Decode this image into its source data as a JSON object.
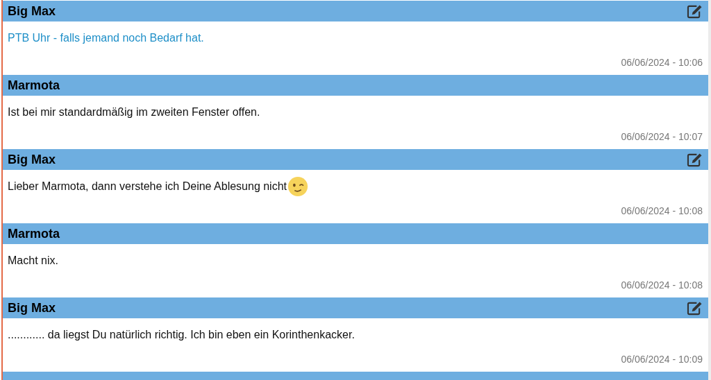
{
  "posts": [
    {
      "author": "Big Max",
      "editable": true,
      "body": {
        "kind": "link",
        "text": "PTB Uhr - falls jemand noch Bedarf hat."
      },
      "time": "06/06/2024 - 10:06"
    },
    {
      "author": "Marmota",
      "editable": false,
      "body": {
        "kind": "text",
        "text": "Ist bei mir standardmäßig im zweiten Fenster offen."
      },
      "time": "06/06/2024 - 10:07"
    },
    {
      "author": "Big Max",
      "editable": true,
      "body": {
        "kind": "text",
        "text": "Lieber Marmota, dann verstehe ich Deine Ablesung nicht",
        "emoji": true
      },
      "time": "06/06/2024 - 10:08"
    },
    {
      "author": "Marmota",
      "editable": false,
      "body": {
        "kind": "text",
        "text": "Macht nix."
      },
      "time": "06/06/2024 - 10:08"
    },
    {
      "author": "Big Max",
      "editable": true,
      "body": {
        "kind": "text",
        "text": "............ da liegst Du natürlich richtig. Ich bin eben ein Korinthenkacker."
      },
      "time": "06/06/2024 - 10:09"
    },
    {
      "editable": false
    }
  ]
}
